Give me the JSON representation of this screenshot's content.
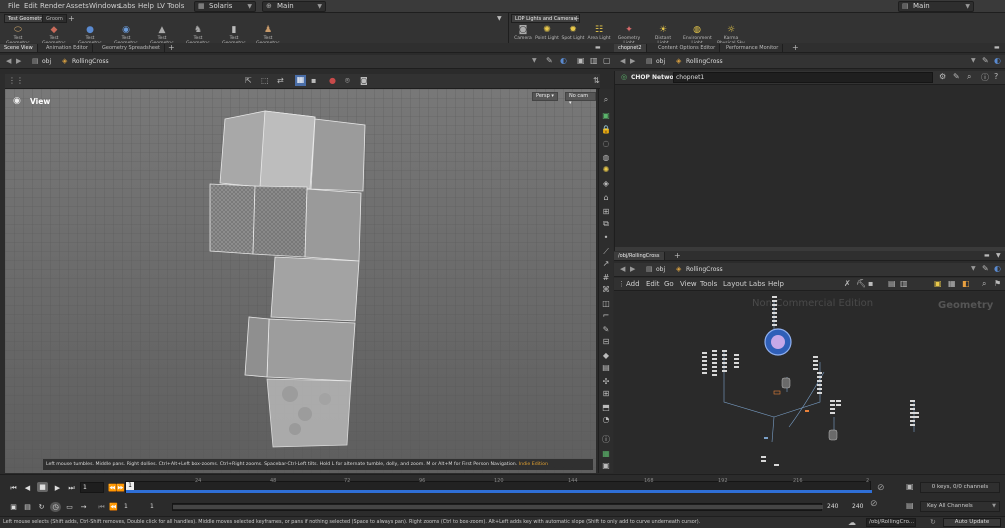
{
  "menubar": {
    "items": [
      "File",
      "Edit",
      "Render",
      "Assets",
      "Windows",
      "Labs",
      "Help",
      "LV Tools"
    ],
    "desktop": "Solaris",
    "context": "Main",
    "right_desktop": "Main"
  },
  "shelf_left": {
    "tabs": [
      "Test Geometry",
      "Groom"
    ],
    "tools": [
      "Test Geometry: C...",
      "Test Geometry: P...",
      "Test Geometry: R...",
      "Test Geometry: S...",
      "Test Geometry: S...",
      "Test Geometry: T...",
      "Test Geometry: T...",
      "Test Geometry: T..."
    ]
  },
  "shelf_right": {
    "tabs": [
      "LOP Lights and Cameras"
    ],
    "tools": [
      "Camera",
      "Point Light",
      "Spot Light",
      "Area Light",
      "Geometry Light",
      "Distant Light",
      "Environment Light",
      "Karma Physical Sky"
    ]
  },
  "left_pane_tabs": [
    "Scene View",
    "Animation Editor",
    "Geometry Spreadsheet"
  ],
  "chop_pane_tabs": [
    "chopnet2",
    "Content Options Editor",
    "Performance Monitor"
  ],
  "viewer_path": {
    "context": "obj",
    "node": "RollingCross"
  },
  "chop_path": {
    "context": "obj",
    "node": "RollingCross"
  },
  "chop_header": {
    "label": "CHOP Network",
    "value": "chopnet1"
  },
  "viewport": {
    "label": "View",
    "persp": "Persp",
    "cam": "No cam",
    "hint": "Left mouse tumbles. Middle pans. Right dollies. Ctrl+Alt+Left box-zooms. Ctrl+Right zooms. Spacebar-Ctrl-Left tilts. Hold L for alternate tumble, dolly, and zoom. M or Alt+M for First Person Navigation.",
    "hint_tail": "Indie Edition"
  },
  "network": {
    "tab": "/obj/RollingCross",
    "path_context": "obj",
    "path_node": "RollingCross",
    "menus": [
      "Add",
      "Edit",
      "Go",
      "View",
      "Tools",
      "Layout",
      "Labs",
      "Help"
    ],
    "watermark": "Non-Commercial Edition",
    "context_label": "Geometry"
  },
  "timeline": {
    "frame": "1",
    "ticks": [
      "24",
      "48",
      "72",
      "96",
      "120",
      "144",
      "168",
      "192",
      "216",
      "2"
    ],
    "start": "1",
    "start2": "1",
    "end": "240",
    "end2": "240",
    "keys_label": "0 keys, 0/0 channels",
    "channels_label": "Key All Channels"
  },
  "status": {
    "message": "Left mouse selects (Shift adds, Ctrl-Shift removes, Double click for all handles). Middle moves selected keyframes, or pans if nothing selected (Space to always pan). Right zooms (Ctrl to box-zoom). Alt+Left adds key with automatic slope (Shift to only add to curve underneath cursor).",
    "path": "/obj/RollingCro...",
    "update_mode": "Auto Update"
  },
  "colors": {
    "accent_blue": "#2f6fd6",
    "node_highlight": "#8f7bd8"
  }
}
